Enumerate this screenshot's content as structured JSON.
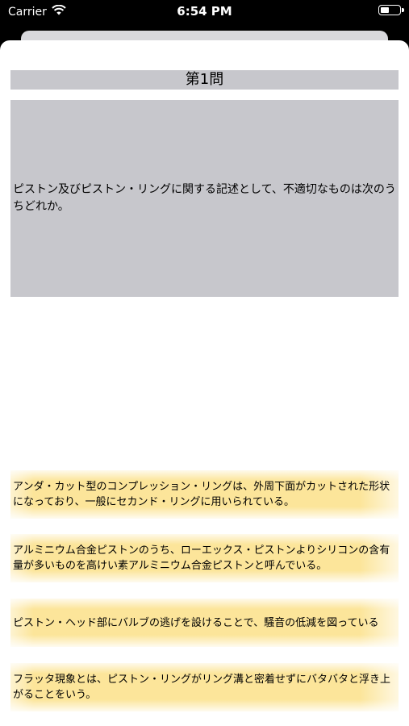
{
  "status_bar": {
    "carrier": "Carrier",
    "time": "6:54 PM"
  },
  "quiz": {
    "title": "第1問",
    "question": "ピストン及びピストン・リングに関する記述として、不適切なものは次のうちどれか。",
    "choices": [
      "アンダ・カット型のコンプレッション・リングは、外周下面がカットされた形状になっており、一般にセカンド・リングに用いられている。",
      "アルミニウム合金ピストンのうち、ローエックス・ピストンよりシリコンの含有量が多いものを高けい素アルミニウム合金ピストンと呼んでいる。",
      "ピストン・ヘッド部にバルブの逃げを設けることで、騒音の低減を図っている",
      "フラッタ現象とは、ピストン・リングがリング溝と密着せずにバタバタと浮き上がることをいう。"
    ]
  },
  "colors": {
    "choice_bg": "#fce59a",
    "question_bg": "#c7c7cc"
  }
}
